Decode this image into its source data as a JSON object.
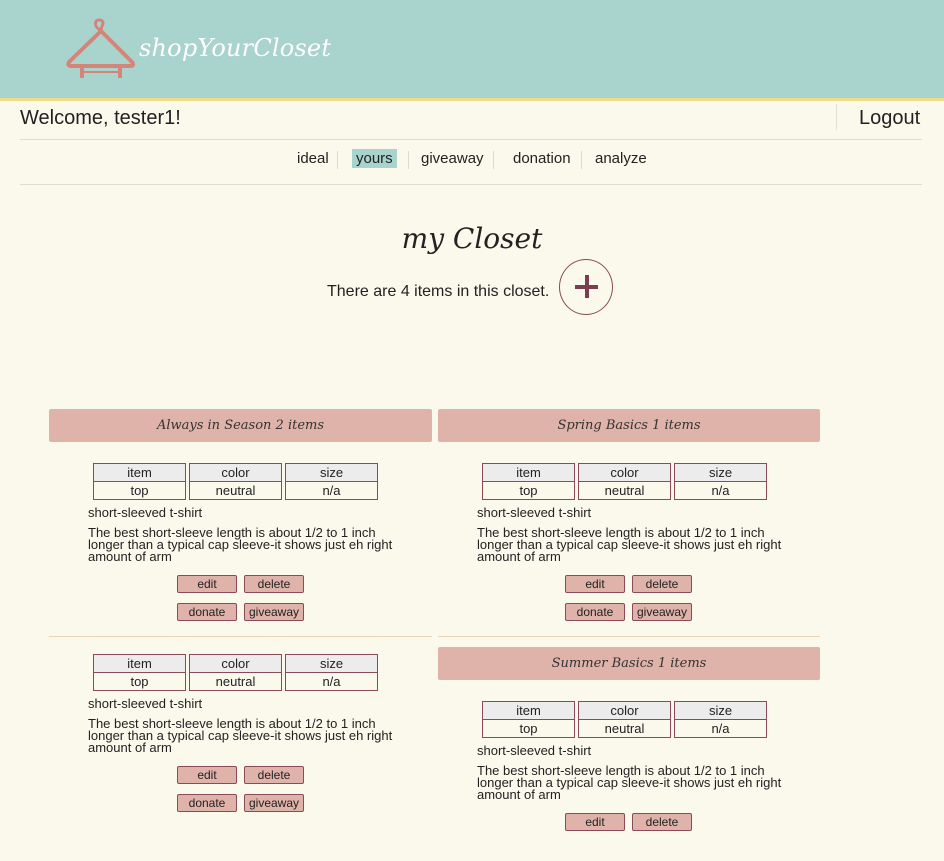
{
  "header": {
    "brand": "shopYourCloset"
  },
  "welcome": "Welcome, tester1!",
  "logout": "Logout",
  "nav": [
    "ideal",
    "yours",
    "giveaway",
    "donation",
    "analyze"
  ],
  "nav_active": "yours",
  "title": "my Closet",
  "count_text": "There are 4 items in this closet.",
  "table_headers": [
    "item",
    "color",
    "size"
  ],
  "closets": [
    {
      "name": "Always in Season 2 items"
    },
    {
      "name": "Spring Basics 1 items"
    },
    {
      "name": "Summer Basics 1 items"
    }
  ],
  "items": [
    {
      "values": [
        "top",
        "neutral",
        "n/a"
      ],
      "name": "short-sleeved t-shirt",
      "desc": "The best short-sleeve length is about 1/2 to 1 inch longer than a typical cap sleeve-it shows just eh right amount of arm"
    },
    {
      "values": [
        "top",
        "neutral",
        "n/a"
      ],
      "name": "short-sleeved t-shirt",
      "desc": "The best short-sleeve length is about 1/2 to 1 inch longer than a typical cap sleeve-it shows just eh right amount of arm"
    },
    {
      "values": [
        "top",
        "neutral",
        "n/a"
      ],
      "name": "short-sleeved t-shirt",
      "desc": "The best short-sleeve length is about 1/2 to 1 inch longer than a typical cap sleeve-it shows just eh right amount of arm"
    },
    {
      "values": [
        "top",
        "neutral",
        "n/a"
      ],
      "name": "short-sleeved t-shirt",
      "desc": "The best short-sleeve length is about 1/2 to 1 inch longer than a typical cap sleeve-it shows just eh right amount of arm"
    }
  ],
  "buttons": {
    "edit": "edit",
    "delete": "delete",
    "donate": "donate",
    "giveaway": "giveaway"
  },
  "icons": {
    "logo": "hanger-icon",
    "add": "plus-icon"
  },
  "colors": {
    "header_bg": "#a9d3cd",
    "page_bg": "#fbf8ec",
    "closet_header_bg": "#dfb3aa",
    "accent_border": "#8a4a5a",
    "logo_hanger": "#d4857a"
  }
}
